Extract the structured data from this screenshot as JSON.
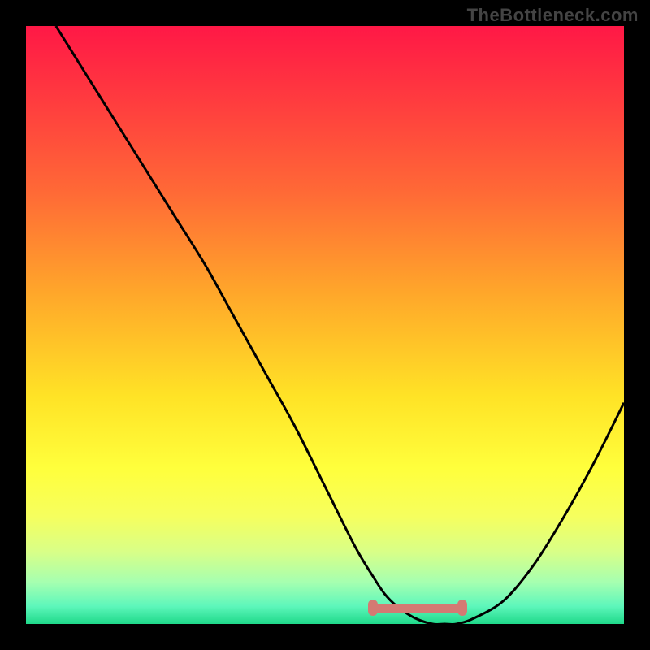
{
  "watermark": "TheBottleneck.com",
  "chart_data": {
    "type": "line",
    "title": "",
    "xlabel": "",
    "ylabel": "",
    "xlim": [
      0,
      100
    ],
    "ylim": [
      0,
      100
    ],
    "grid": false,
    "series": [
      {
        "name": "curve",
        "x": [
          5,
          10,
          15,
          20,
          25,
          30,
          35,
          40,
          45,
          50,
          55,
          58,
          60,
          62,
          65,
          68,
          70,
          72,
          75,
          80,
          85,
          90,
          95,
          100
        ],
        "y": [
          100,
          92,
          84,
          76,
          68,
          60,
          51,
          42,
          33,
          23,
          13,
          8,
          5,
          3,
          1,
          0,
          0,
          0,
          1,
          4,
          10,
          18,
          27,
          37
        ]
      }
    ],
    "valley_band": {
      "x_start": 58,
      "x_end": 73,
      "y": 0
    },
    "colors": {
      "curve": "#000000",
      "valley_marker": "#d47a73",
      "gradient_top": "#ff1846",
      "gradient_bottom": "#1fd98a",
      "frame": "#000000"
    }
  }
}
